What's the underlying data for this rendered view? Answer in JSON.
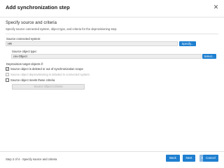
{
  "dialog": {
    "title": "Add synchronization step",
    "close_icon": "close-icon"
  },
  "step": {
    "heading": "Specify source and criteria",
    "description": "Specify source connected system, object type, and criteria for the deprovisioning step."
  },
  "source_system": {
    "label": "Source connected system:",
    "value": "HR",
    "button": "Specify..."
  },
  "source_object_type": {
    "label": "Source object type:",
    "value": "csv-Object",
    "button": "Select..."
  },
  "deprovision": {
    "label": "Deprovision target objects if:",
    "options": [
      {
        "label": "Source object is deleted or out of synchronization scope",
        "checked": true,
        "disabled": false
      },
      {
        "label": "Source object deprovisioning is initiated in connected system",
        "checked": false,
        "disabled": true
      },
      {
        "label": "Source object meets these criteria",
        "checked": false,
        "disabled": false
      }
    ],
    "criteria_button": "Source Object Criteria"
  },
  "footer": {
    "status": "Step 2 of 4 - Specify source and criteria",
    "back": "Back",
    "next": "Next",
    "save": "Save",
    "cancel": "Cancel"
  },
  "colors": {
    "accent": "#1e7fd0",
    "accent_disabled": "#8db9e2"
  }
}
